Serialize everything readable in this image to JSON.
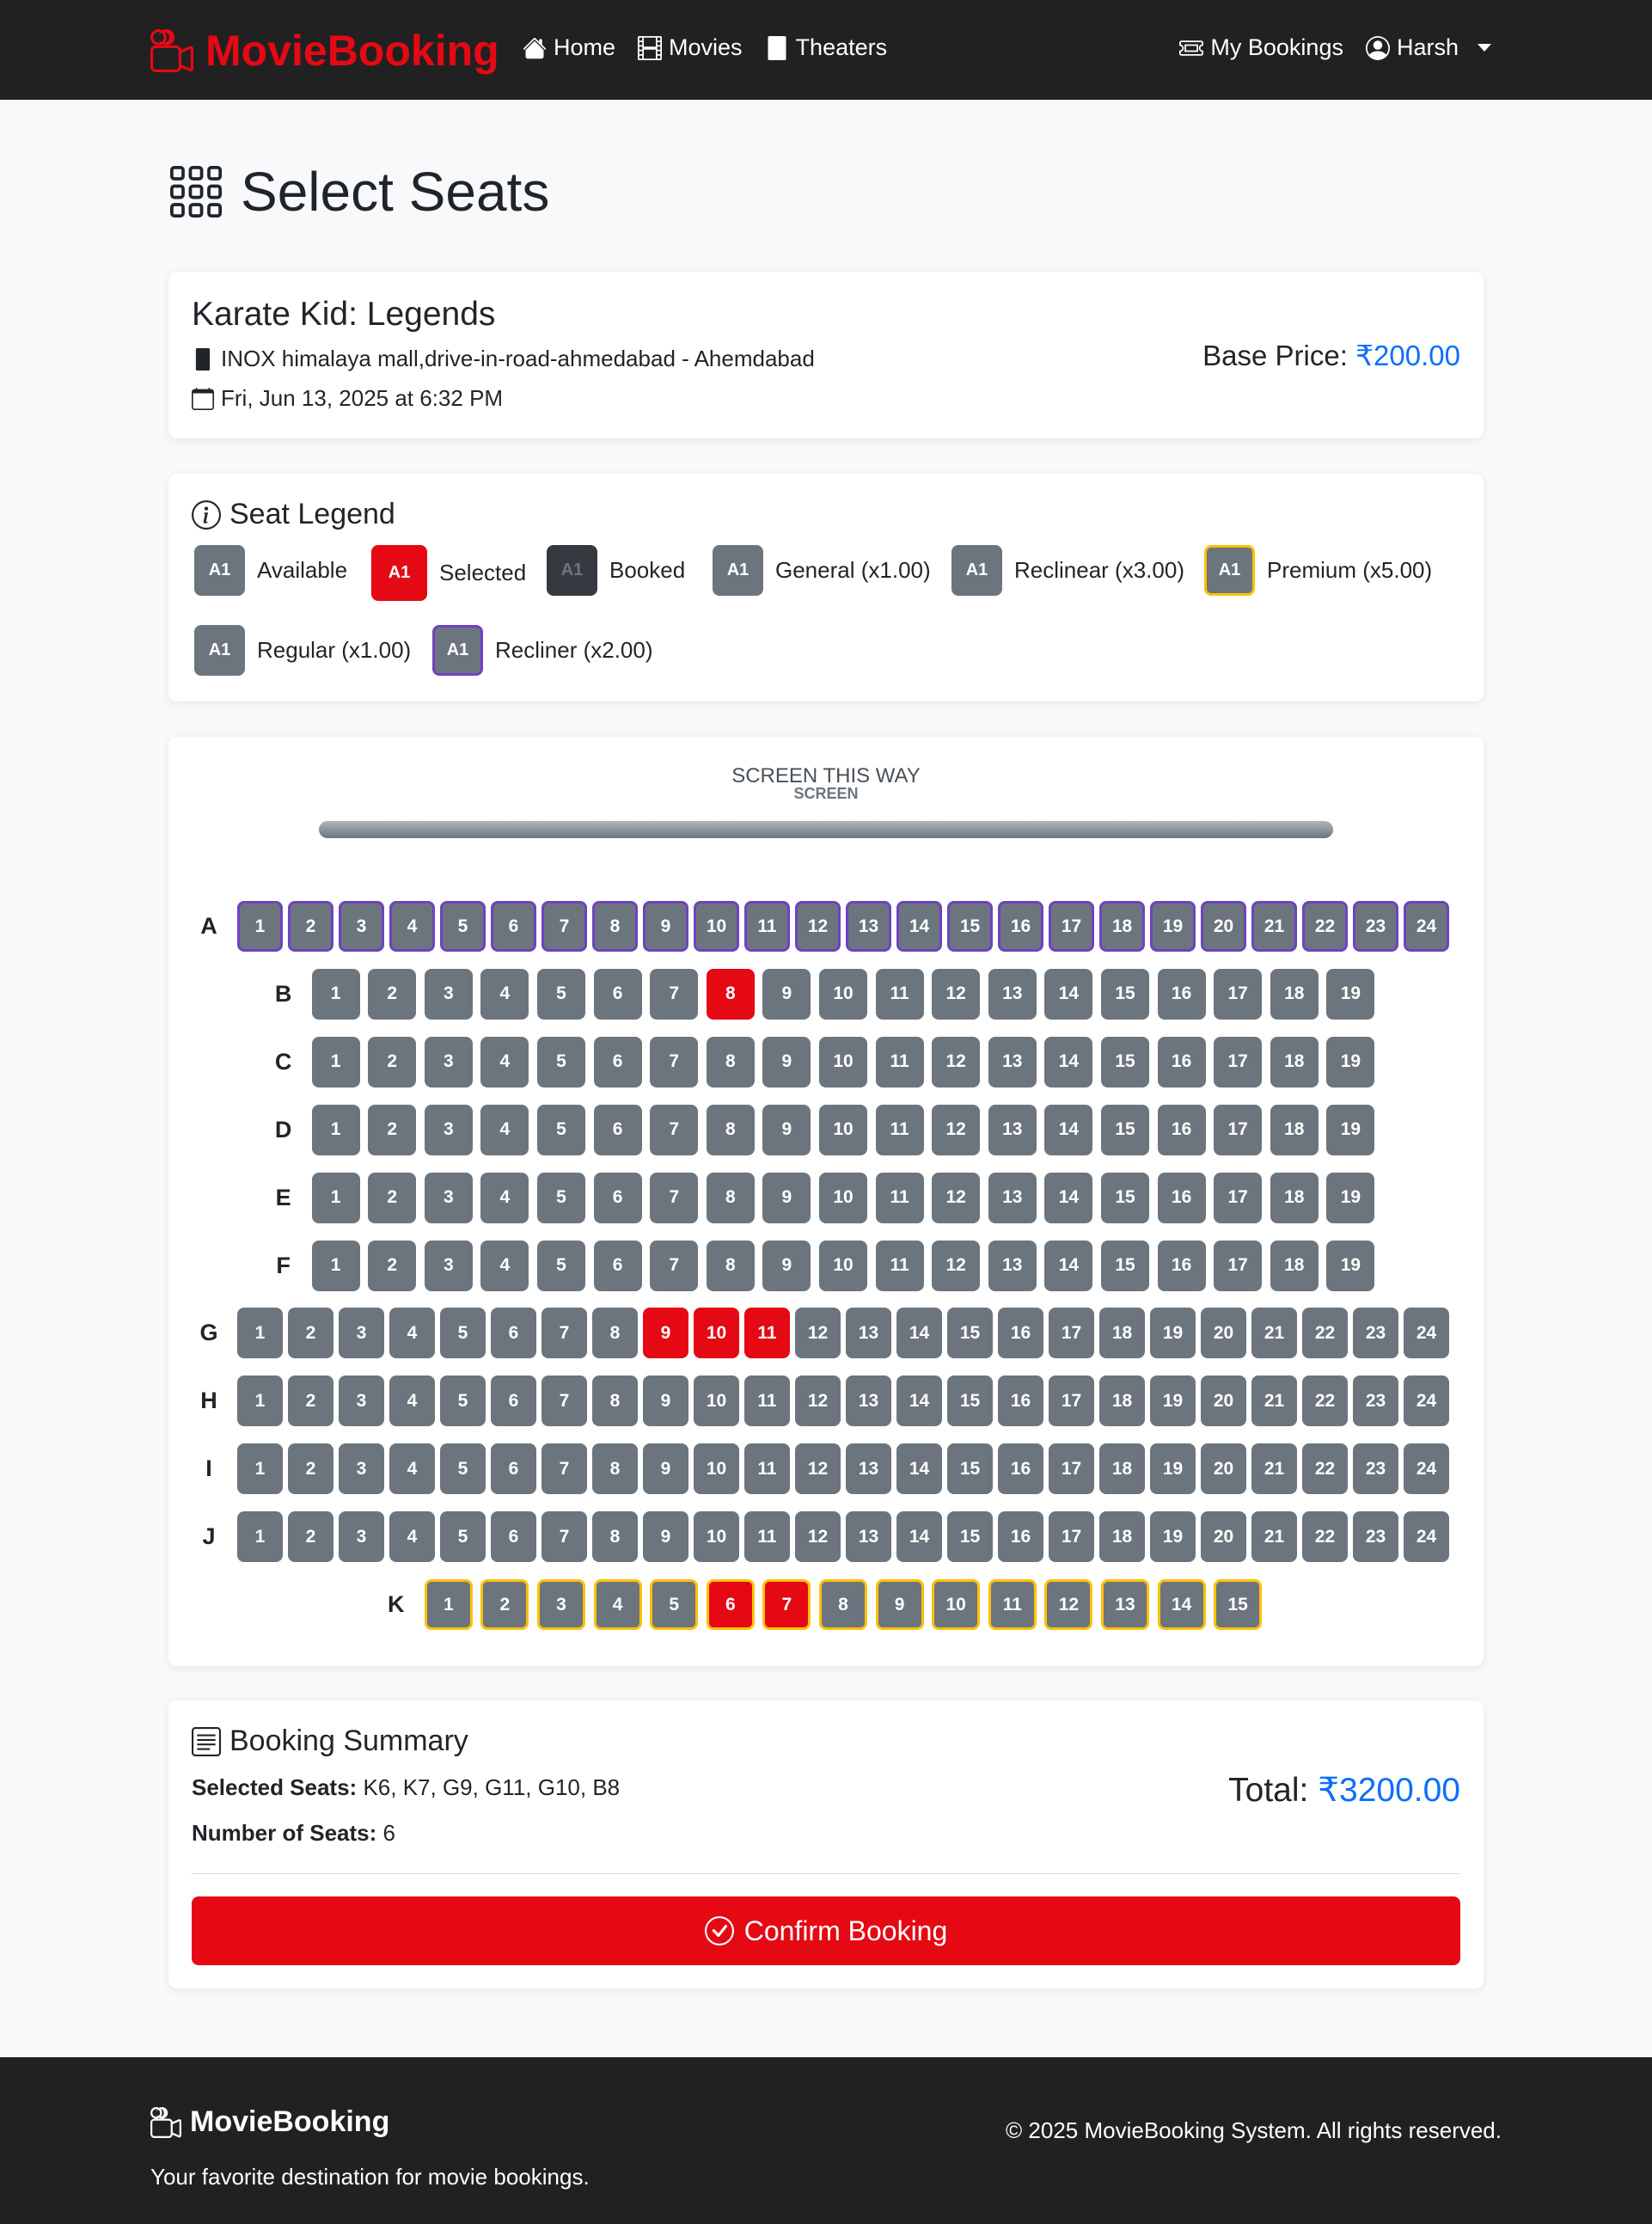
{
  "colors": {
    "brand": "#e50914",
    "navbar_bg": "#212121",
    "seat_available": "#6c757d",
    "seat_selected": "#e50914",
    "seat_booked": "#343a40",
    "recliner_border": "#6f42c1",
    "premium_border": "#ffc107",
    "price_blue": "#0d6efd"
  },
  "navbar": {
    "brand": "MovieBooking",
    "brand_icon": "camera-reels-icon",
    "links": [
      {
        "label": "Home",
        "icon": "house-icon"
      },
      {
        "label": "Movies",
        "icon": "film-icon"
      },
      {
        "label": "Theaters",
        "icon": "building-icon"
      }
    ],
    "my_bookings": {
      "label": "My Bookings",
      "icon": "ticket-icon"
    },
    "user": {
      "label": "Harsh",
      "icon": "person-circle-icon"
    }
  },
  "page_title": "Select Seats",
  "movie": {
    "title": "Karate Kid: Legends",
    "theater": "INOX himalaya mall,drive-in-road-ahmedabad - Ahemdabad",
    "datetime": "Fri, Jun 13, 2025 at 6:32 PM",
    "base_price_label": "Base Price:",
    "base_price": "₹200.00"
  },
  "legend": {
    "title": "Seat Legend",
    "sample": "A1",
    "items": [
      {
        "label": "Available"
      },
      {
        "label": "Selected"
      },
      {
        "label": "Booked"
      },
      {
        "label": "General (x1.00)"
      },
      {
        "label": "Reclinear (x3.00)"
      },
      {
        "label": "Premium (x5.00)"
      },
      {
        "label": "Regular (x1.00)"
      },
      {
        "label": "Recliner (x2.00)"
      }
    ]
  },
  "screen": {
    "label": "SCREEN THIS WAY",
    "small_label": "SCREEN"
  },
  "seat_rows": [
    {
      "row": "A",
      "count": 24,
      "type": "recliner",
      "selected": []
    },
    {
      "row": "B",
      "count": 19,
      "type": "regular",
      "selected": [
        8
      ]
    },
    {
      "row": "C",
      "count": 19,
      "type": "regular",
      "selected": []
    },
    {
      "row": "D",
      "count": 19,
      "type": "regular",
      "selected": []
    },
    {
      "row": "E",
      "count": 19,
      "type": "regular",
      "selected": []
    },
    {
      "row": "F",
      "count": 19,
      "type": "regular",
      "selected": []
    },
    {
      "row": "G",
      "count": 24,
      "type": "regular",
      "selected": [
        9,
        10,
        11
      ]
    },
    {
      "row": "H",
      "count": 24,
      "type": "regular",
      "selected": []
    },
    {
      "row": "I",
      "count": 24,
      "type": "regular",
      "selected": []
    },
    {
      "row": "J",
      "count": 24,
      "type": "regular",
      "selected": []
    },
    {
      "row": "K",
      "count": 15,
      "type": "premium",
      "selected": [
        6,
        7
      ]
    }
  ],
  "summary": {
    "title": "Booking Summary",
    "selected_seats_label": "Selected Seats:",
    "selected_seats": "K6, K7, G9, G11, G10, B8",
    "number_label": "Number of Seats:",
    "number": "6",
    "total_label": "Total:",
    "total": "₹3200.00",
    "confirm_label": "Confirm Booking"
  },
  "footer": {
    "brand": "MovieBooking",
    "tagline": "Your favorite destination for movie bookings.",
    "copyright": "© 2025 MovieBooking System. All rights reserved."
  }
}
